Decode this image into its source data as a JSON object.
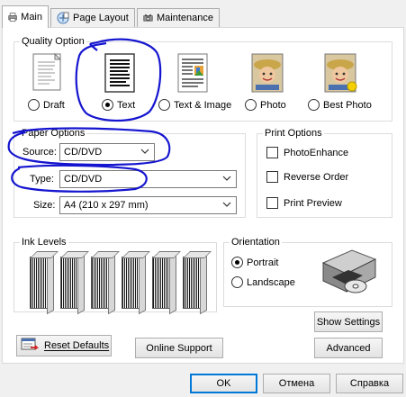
{
  "tabs": [
    {
      "label": "Main",
      "icon": "printer-icon",
      "active": true
    },
    {
      "label": "Page Layout",
      "icon": "page-layout-icon",
      "active": false
    },
    {
      "label": "Maintenance",
      "icon": "maintenance-icon",
      "active": false
    }
  ],
  "quality": {
    "title": "Quality Option",
    "options": [
      {
        "label": "Draft",
        "checked": false
      },
      {
        "label": "Text",
        "checked": true
      },
      {
        "label": "Text & Image",
        "checked": false
      },
      {
        "label": "Photo",
        "checked": false
      },
      {
        "label": "Best Photo",
        "checked": false
      }
    ]
  },
  "paper": {
    "title": "Paper Options",
    "source_label": "Source:",
    "source_value": "CD/DVD",
    "type_label": "Type:",
    "type_value": "CD/DVD",
    "size_label": "Size:",
    "size_value": "A4 (210 x 297 mm)"
  },
  "print_options": {
    "title": "Print Options",
    "items": [
      "PhotoEnhance",
      "Reverse Order",
      "Print Preview"
    ]
  },
  "ink": {
    "title": "Ink Levels",
    "count": 6
  },
  "orientation": {
    "title": "Orientation",
    "portrait": "Portrait",
    "landscape": "Landscape",
    "selected": "Portrait"
  },
  "buttons": {
    "show_settings": "Show Settings",
    "reset_defaults": "Reset Defaults",
    "online_support": "Online Support",
    "advanced": "Advanced",
    "ok": "OK",
    "cancel": "Отмена",
    "help": "Справка"
  },
  "colors": {
    "annotation": "#1515d0",
    "accent": "#0078d7"
  }
}
